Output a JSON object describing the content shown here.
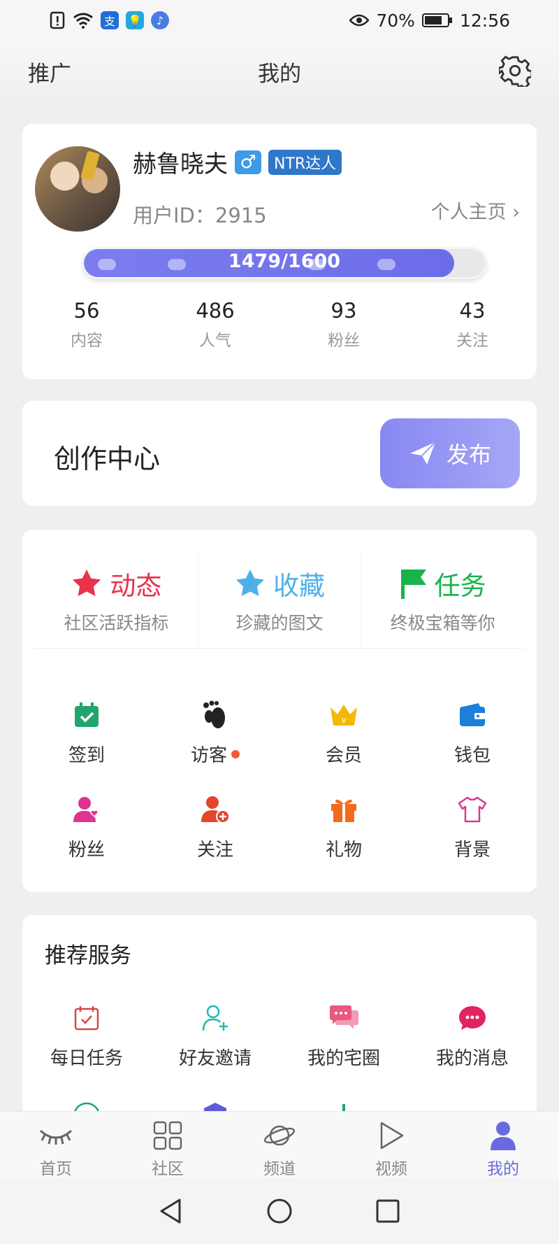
{
  "status_bar": {
    "battery_percent": "70%",
    "time": "12:56",
    "left_icons": [
      "alert-icon",
      "wifi-icon",
      "app-icon-alipay",
      "app-icon-bulb",
      "music-icon"
    ]
  },
  "header": {
    "left_label": "推广",
    "title": "我的"
  },
  "profile": {
    "name": "赫鲁晓夫",
    "gender_symbol": "♂",
    "badge": "NTR达人",
    "user_id": "用户ID：2915",
    "homepage_link": "个人主页 ›",
    "exp_text": "1479/1600",
    "exp_fraction": 0.924,
    "stats": [
      {
        "value": "56",
        "label": "内容"
      },
      {
        "value": "486",
        "label": "人气"
      },
      {
        "value": "93",
        "label": "粉丝"
      },
      {
        "value": "43",
        "label": "关注"
      }
    ]
  },
  "creation_center": {
    "title": "创作中心",
    "publish_label": "发布"
  },
  "features": [
    {
      "title": "动态",
      "subtitle": "社区活跃指标",
      "color": "#e8334a"
    },
    {
      "title": "收藏",
      "subtitle": "珍藏的图文",
      "color": "#4fb0e8"
    },
    {
      "title": "任务",
      "subtitle": "终极宝箱等你",
      "color": "#19b24b"
    }
  ],
  "grid_items": [
    {
      "label": "签到",
      "icon": "calendar-check-icon"
    },
    {
      "label": "访客",
      "icon": "footprint-icon",
      "has_dot": true
    },
    {
      "label": "会员",
      "icon": "crown-icon"
    },
    {
      "label": "钱包",
      "icon": "wallet-icon"
    },
    {
      "label": "粉丝",
      "icon": "fan-user-icon"
    },
    {
      "label": "关注",
      "icon": "follow-user-icon"
    },
    {
      "label": "礼物",
      "icon": "gift-icon"
    },
    {
      "label": "背景",
      "icon": "tshirt-icon"
    }
  ],
  "recommended": {
    "title": "推荐服务",
    "items": [
      {
        "label": "每日任务",
        "icon": "daily-task-icon"
      },
      {
        "label": "好友邀请",
        "icon": "invite-friend-icon"
      },
      {
        "label": "我的宅圈",
        "icon": "chat-bubbles-icon"
      },
      {
        "label": "我的消息",
        "icon": "message-icon"
      }
    ]
  },
  "tab_bar": [
    {
      "label": "首页",
      "icon": "eye-lashes-icon"
    },
    {
      "label": "社区",
      "icon": "grid-icon"
    },
    {
      "label": "频道",
      "icon": "planet-icon"
    },
    {
      "label": "视频",
      "icon": "play-icon"
    },
    {
      "label": "我的",
      "icon": "user-icon",
      "active": true
    }
  ],
  "colors": {
    "accent": "#6a6ae0",
    "publish_gradient_start": "#8888f2",
    "badge_blue": "#2e77c9"
  }
}
